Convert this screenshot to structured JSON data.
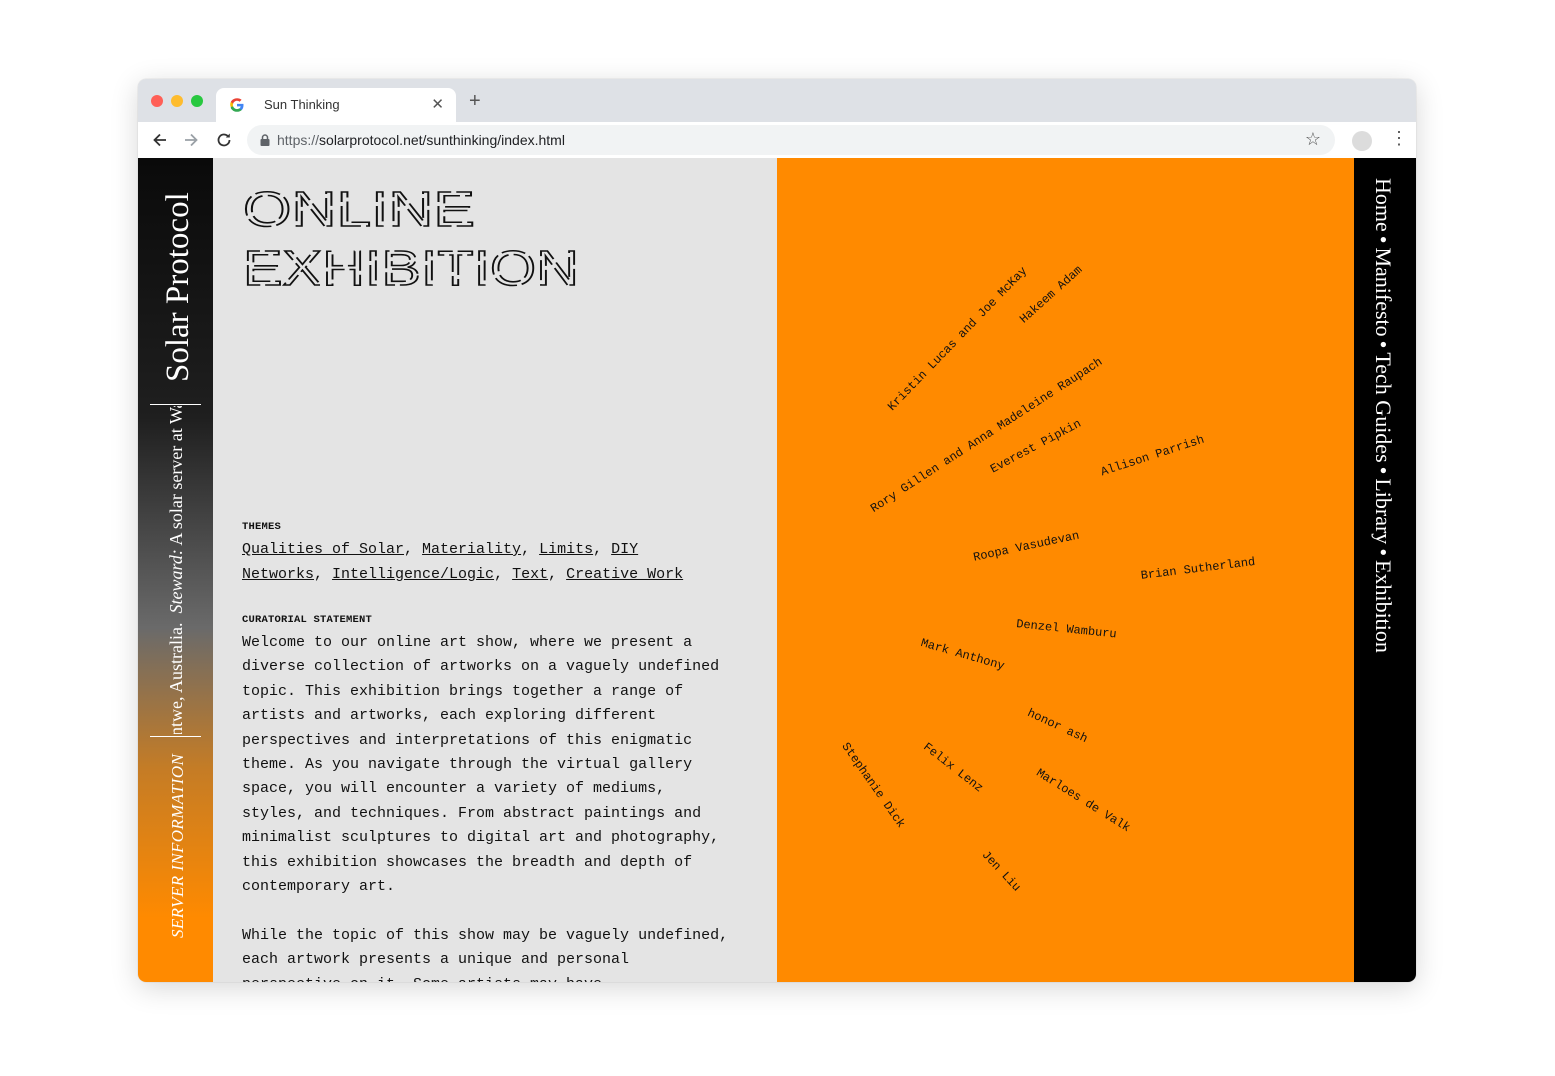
{
  "browser": {
    "tab_title": "Sun Thinking",
    "url_prefix": "https://",
    "url_rest": "solarprotocol.net/sunthinking/index.html"
  },
  "sidebar": {
    "brand": "Solar Protocol",
    "steward_label": "Steward:",
    "steward_text": "A solar server at Wai",
    "steward_location": "ntwe, Australia.",
    "server_information": "SERVER INFORMATION"
  },
  "header": {
    "title_line1": "ONLINE",
    "title_line2": "EXHIBITION"
  },
  "themes": {
    "heading": "THEMES",
    "links": [
      "Qualities of Solar",
      "Materiality",
      "Limits",
      "DIY Networks",
      "Intelligence/Logic",
      "Text",
      "Creative Work"
    ]
  },
  "statement": {
    "heading": "CURATORIAL STATEMENT",
    "p1": "Welcome to our online art show, where we present a diverse collection of artworks on a vaguely undefined topic. This exhibition brings together a range of artists and artworks, each exploring different perspectives and interpretations of this enigmatic theme. As you navigate through the virtual gallery space, you will encounter a variety of mediums, styles, and techniques. From abstract paintings and minimalist sculptures to digital art and photography, this exhibition showcases the breadth and depth of contemporary art.",
    "p2": "While the topic of this show may be vaguely undefined, each artwork presents a unique and personal perspective on it. Some artists may have"
  },
  "artists": [
    {
      "name": "Kristin Lucas and Joe McKay",
      "angle": -46
    },
    {
      "name": "Hakeem Adam",
      "angle": -42
    },
    {
      "name": "Rory Gillen and Anna Madeleine Raupach",
      "angle": -33
    },
    {
      "name": "Everest Pipkin",
      "angle": -28
    },
    {
      "name": "Allison Parrish",
      "angle": -18
    },
    {
      "name": "Roopa Vasudevan",
      "angle": -12
    },
    {
      "name": "Brian Sutherland",
      "angle": -7
    },
    {
      "name": "Denzel Wamburu",
      "angle": 6
    },
    {
      "name": "Mark Anthony",
      "angle": 16
    },
    {
      "name": "honor ash",
      "angle": 25
    },
    {
      "name": "Marloes de Valk",
      "angle": 32
    },
    {
      "name": "Felix Lenz",
      "angle": 38
    },
    {
      "name": "Stephanie Dick",
      "angle": 55
    },
    {
      "name": "Jen Liu",
      "angle": 47
    }
  ],
  "right_nav": {
    "items": [
      "Home",
      "Manifesto",
      "Tech Guides",
      "Library",
      "Exhibition"
    ],
    "separator": "•"
  }
}
